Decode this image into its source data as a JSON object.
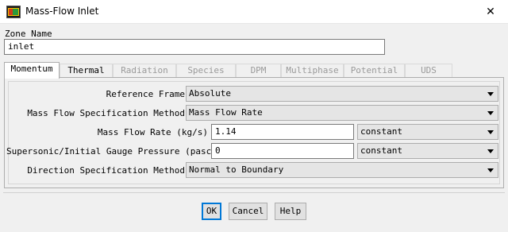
{
  "window": {
    "title": "Mass-Flow Inlet",
    "close_glyph": "✕"
  },
  "zone": {
    "label": "Zone Name",
    "value": "inlet"
  },
  "tabs": [
    {
      "label": "Momentum",
      "state": "active"
    },
    {
      "label": "Thermal",
      "state": "enabled"
    },
    {
      "label": "Radiation",
      "state": "disabled"
    },
    {
      "label": "Species",
      "state": "disabled"
    },
    {
      "label": "DPM",
      "state": "disabled"
    },
    {
      "label": "Multiphase",
      "state": "disabled"
    },
    {
      "label": "Potential",
      "state": "disabled"
    },
    {
      "label": "UDS",
      "state": "disabled"
    }
  ],
  "form": {
    "reference_frame": {
      "label": "Reference Frame",
      "value": "Absolute"
    },
    "mass_flow_spec": {
      "label": "Mass Flow Specification Method",
      "value": "Mass Flow Rate"
    },
    "mass_flow_rate": {
      "label": "Mass Flow Rate (kg/s)",
      "value": "1.14",
      "profile": "constant"
    },
    "gauge_pressure": {
      "label": "Supersonic/Initial Gauge Pressure (pascal)",
      "value": "0",
      "profile": "constant"
    },
    "direction_spec": {
      "label": "Direction Specification Method",
      "value": "Normal to Boundary"
    }
  },
  "buttons": {
    "ok": "OK",
    "cancel": "Cancel",
    "help": "Help"
  }
}
